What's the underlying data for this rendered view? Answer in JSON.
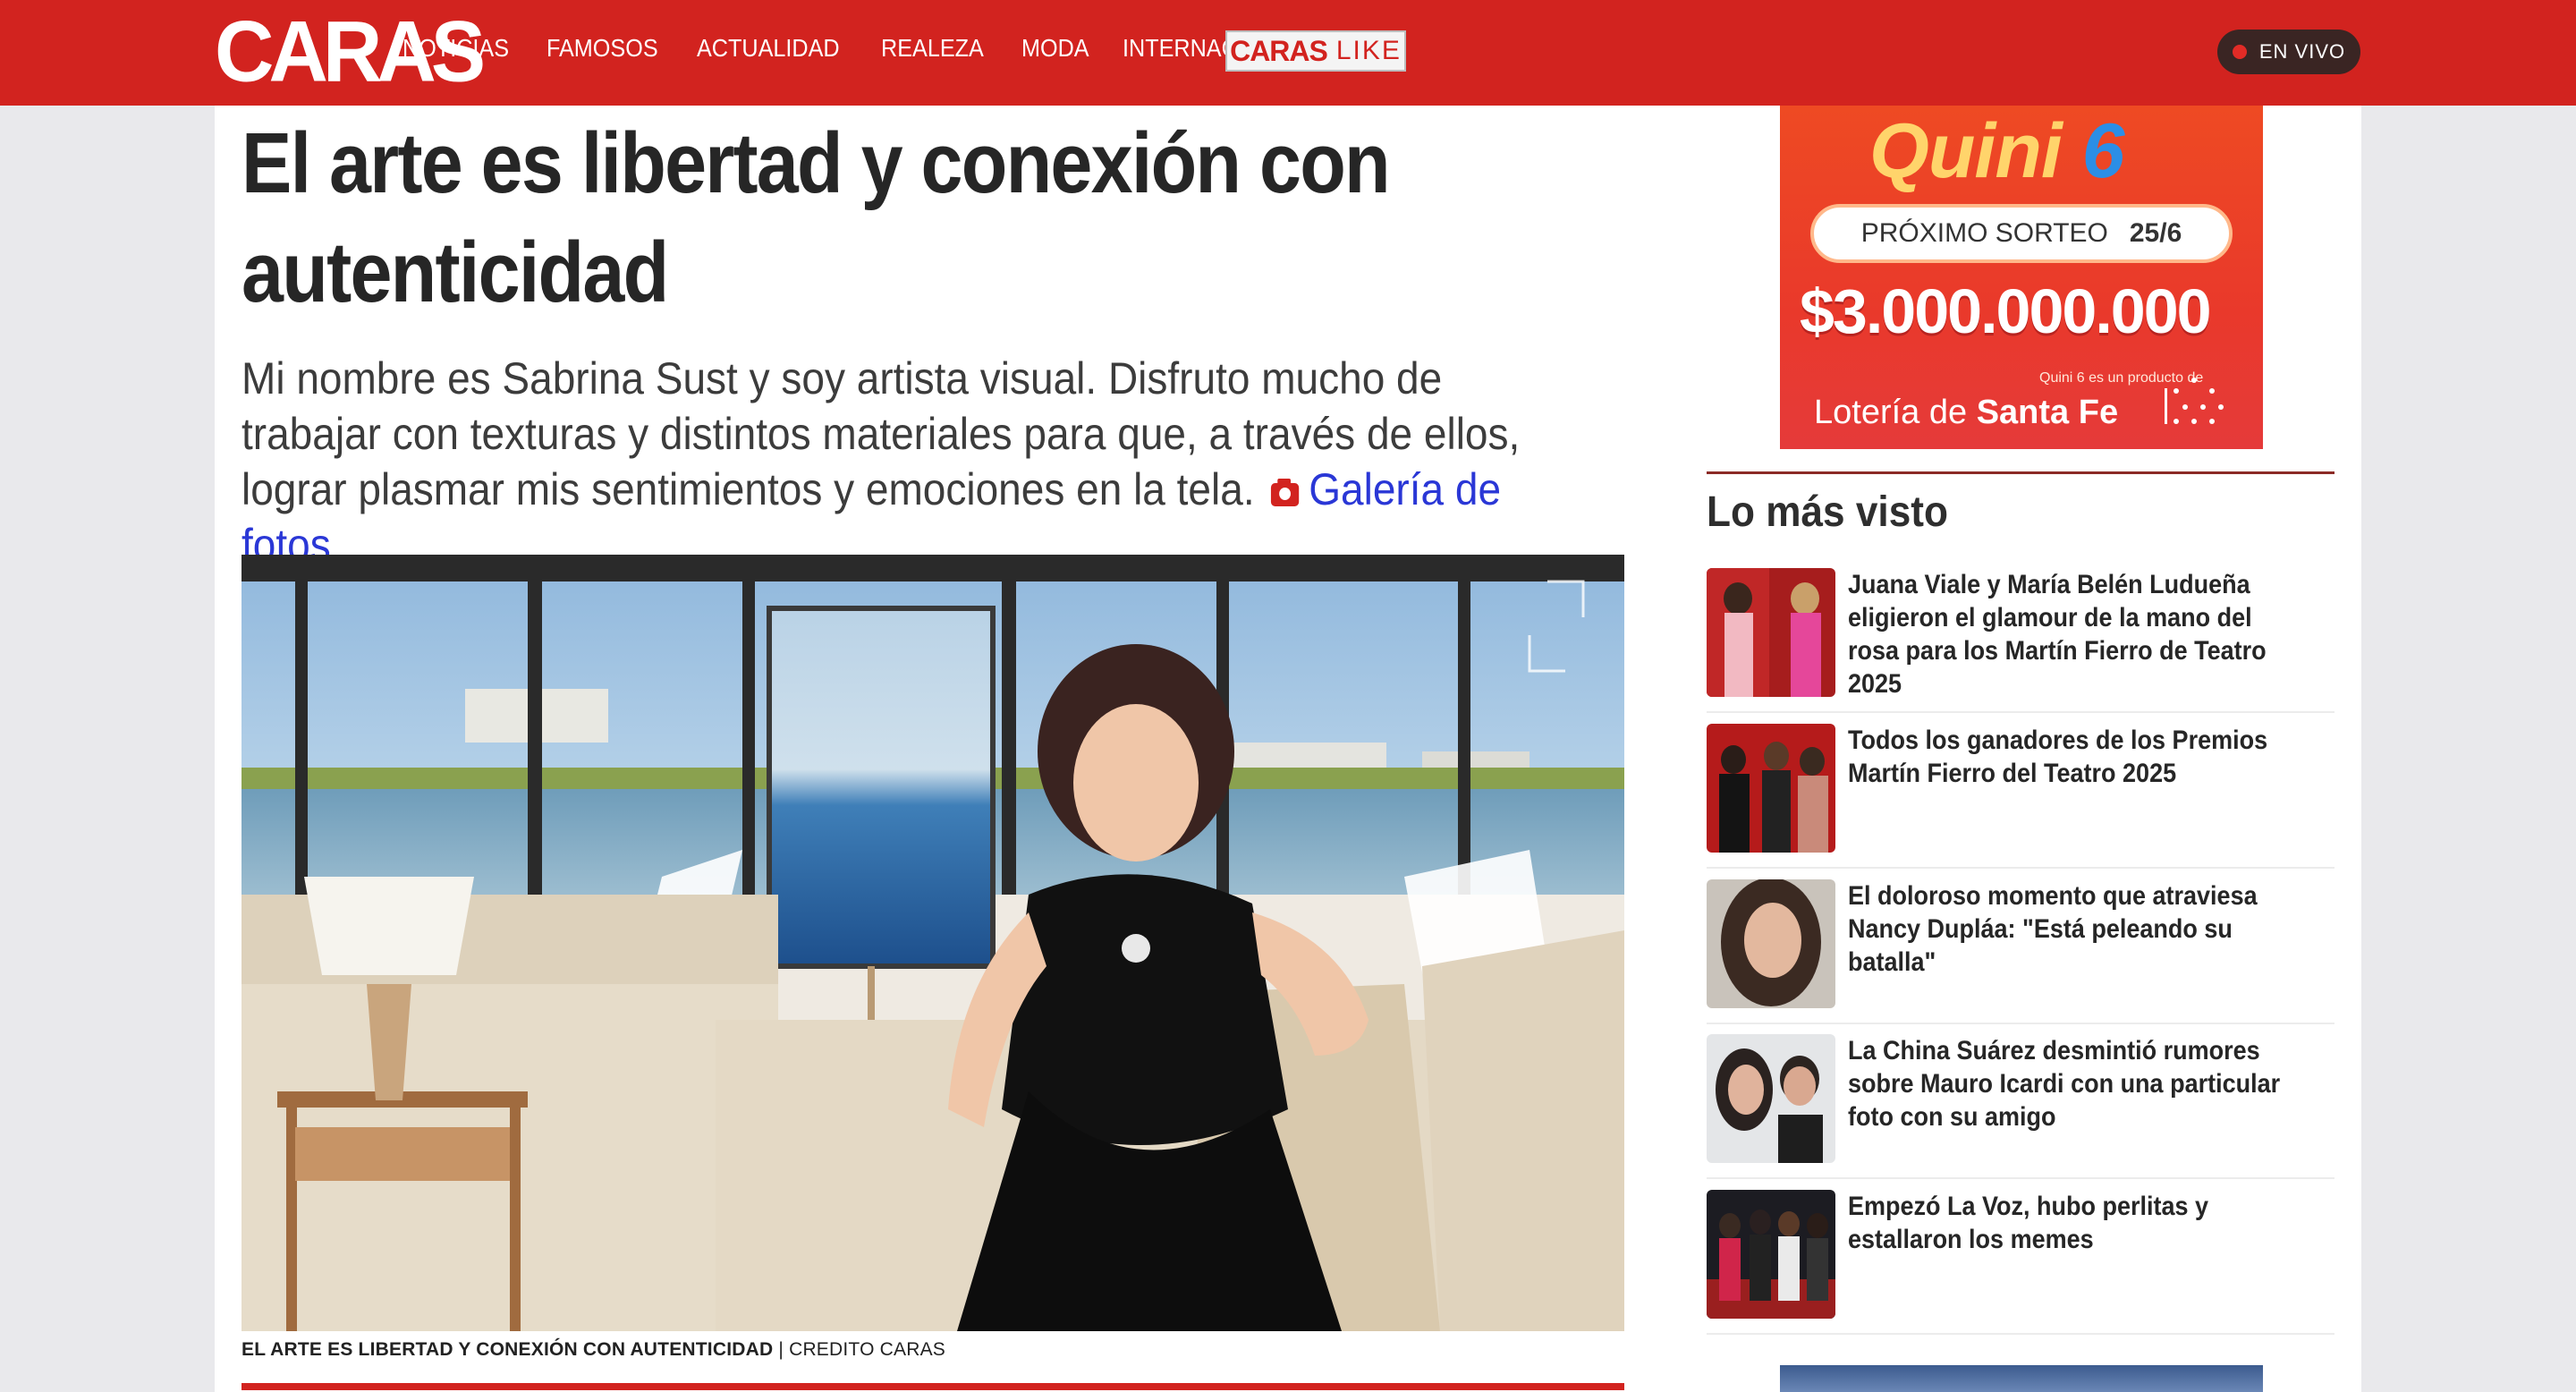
{
  "header": {
    "logo": "CARAS",
    "nav": [
      "NOTICIAS",
      "FAMOSOS",
      "ACTUALIDAD",
      "REALEZA",
      "MODA",
      "INTERNACIONAL"
    ],
    "caras_like": {
      "part1": "CARAS",
      "part2": "LIKE"
    },
    "live_label": "EN VIVO"
  },
  "article": {
    "headline": "El arte es libertad y conexión con autenticidad",
    "lead": "Mi nombre es Sabrina Sust y soy artista visual. Disfruto mucho de trabajar con texturas y distintos materiales para que, a través de ellos, lograr plasmar mis sentimientos y emociones en la tela.",
    "gallery_link": "Galería de fotos",
    "caption_title": "EL ARTE ES LIBERTAD Y CONEXIÓN CON AUTENTICIDAD",
    "caption_credit": "| CREDITO CARAS"
  },
  "ad": {
    "brand": "Quini",
    "brand_num": "6",
    "next_label": "PRÓXIMO SORTEO",
    "next_date": "25/6",
    "amount": "$3.000.000.000",
    "small_note": "Quini 6 es un producto de",
    "lottery_prefix": "Lotería de",
    "lottery_name": "Santa Fe"
  },
  "most_viewed": {
    "title": "Lo más visto",
    "items": [
      {
        "title": "Juana Viale y María Belén Ludueña eligieron el glamour de la mano del rosa para los Martín Fierro de Teatro 2025"
      },
      {
        "title": "Todos los ganadores de los Premios Martín Fierro del Teatro 2025"
      },
      {
        "title": "El doloroso momento que atraviesa Nancy Dupláa: \"Está peleando su batalla\""
      },
      {
        "title": "La China Suárez desmintió rumores sobre Mauro Icardi con una particular foto con su amigo"
      },
      {
        "title": "Empezó La Voz, hubo perlitas y estallaron los memes"
      }
    ]
  },
  "colors": {
    "brand_red": "#d2231f",
    "link_blue": "#2a37d6"
  }
}
